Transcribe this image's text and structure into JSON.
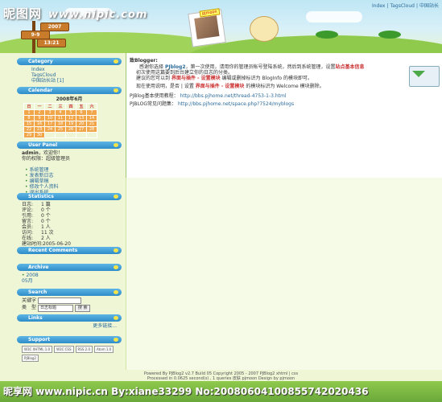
{
  "header": {
    "watermark": "昵图网",
    "watermark_url": "www.nipic.com",
    "topnav": [
      "Index",
      "TagsCloud",
      "中国站长"
    ],
    "sign_labels": [
      "2007",
      "9-9",
      "13:21"
    ],
    "photo_tag": "pjmoon"
  },
  "sidebar": {
    "category": {
      "title": "Category",
      "items": [
        "Index",
        "TagsCloud",
        "中国站长站 [1]"
      ]
    },
    "calendar": {
      "title": "Calendar",
      "month": "2008年6月",
      "days_header": [
        "日",
        "一",
        "二",
        "三",
        "四",
        "五",
        "六"
      ],
      "weeks": [
        [
          "1",
          "2",
          "3",
          "4",
          "5",
          "6",
          "7"
        ],
        [
          "8",
          "9",
          "10",
          "11",
          "12",
          "13",
          "14"
        ],
        [
          "15",
          "16",
          "17",
          "18",
          "19",
          "20",
          "21"
        ],
        [
          "22",
          "23",
          "24",
          "25",
          "26",
          "27",
          "28"
        ],
        [
          "29",
          "30",
          "",
          "",
          "",
          "",
          ""
        ]
      ]
    },
    "userpanel": {
      "title": "User Panel",
      "greeting_user": "admin",
      "greeting_text": "，欢迎你！",
      "role": "你的权限：超级管理员",
      "links": [
        "系统管理",
        "发表新日志",
        "编辑草稿",
        "修改个人资料",
        "退出系统"
      ]
    },
    "statistics": {
      "title": "Statistics",
      "rows": [
        {
          "k": "日志:",
          "v": "1 篇"
        },
        {
          "k": "评论:",
          "v": "0 个"
        },
        {
          "k": "引用:",
          "v": "0 个"
        },
        {
          "k": "留言:",
          "v": "0 个"
        },
        {
          "k": "会员:",
          "v": "1 人"
        },
        {
          "k": "访问:",
          "v": "11 次"
        },
        {
          "k": "在线:",
          "v": "2 人"
        },
        {
          "k": "建站时间:",
          "v": "2005-06-20"
        }
      ]
    },
    "recent": {
      "title": "Recent Comments"
    },
    "archive": {
      "title": "Archive",
      "items": [
        "2008",
        "05月"
      ]
    },
    "search": {
      "title": "Search",
      "label_keyword": "关键字",
      "label_type": "类　型",
      "type_value": "日志标题",
      "button": "搜 索"
    },
    "links": {
      "title": "Links",
      "more": "更多链接..."
    },
    "support": {
      "title": "Support",
      "badges": [
        "W3C XHTML 1.0",
        "W3C CSS",
        "RSS 2.0",
        "Atom 1.0",
        "PJBlog2"
      ]
    }
  },
  "content": {
    "title": "致Blogger:",
    "p1_a": "感谢你选择",
    "p1_brand": "PJblog2",
    "p1_b": "，第一次使用，请用你的管理员帐号登陆系统，然后到系统管理，设置",
    "p1_hl": "站点基本信息",
    "p2": "初次使用这篇要到后台建立你的日志的分类。",
    "p3_a": "建议的您可以到",
    "p3_hl": "界面与插件 - 设置模块",
    "p3_b": "编辑或删掉标识为 BlogInfo 的模块即可。",
    "p4_a": "现在使用说明，是否 | 设置",
    "p4_hl": "界面与插件 - 设置模块",
    "p4_b": "的模块标识为 Welcome 模块删除。",
    "tutorial_label": "PJBlog基本使用教程：",
    "tutorial_url": "http://bbs.pjhome.net/thread-4753-1-3.html",
    "faq_label": "PJBLOG常见问题集：",
    "faq_url": "http://bbs.pjhome.net/space.php?7524/myblogs"
  },
  "footer": {
    "line1": "Powered By PJBlog2 v2.7 Build 05 Copyright 2005 - 2007 PJBlog2 xhtml | css",
    "line2": "Processed in 0.0625 second(s) , 1 queries  皮肤 pjmoon Design by pjmoon"
  },
  "bottom_watermark": "昵享网 www.nipic.cn  By:xiane33299  No:20080604100855742020436"
}
